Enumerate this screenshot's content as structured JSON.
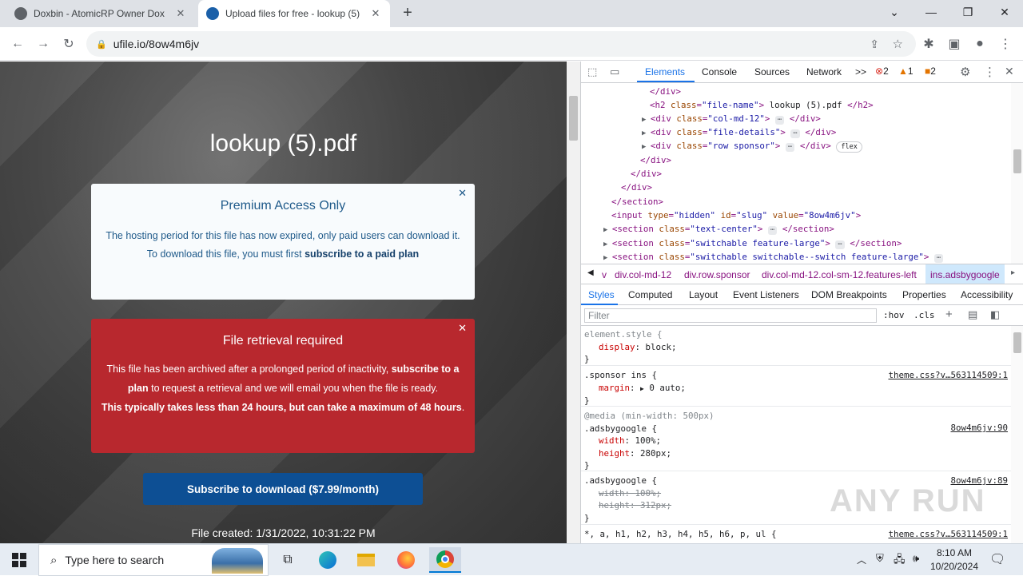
{
  "browser": {
    "tabs": [
      {
        "title": "Doxbin - AtomicRP Owner Dox",
        "active": false
      },
      {
        "title": "Upload files for free - lookup (5)",
        "active": true
      }
    ],
    "url": "ufile.io/8ow4m6jv",
    "new_tab_label": "+"
  },
  "page": {
    "file_name": "lookup (5).pdf",
    "premium": {
      "title": "Premium Access Only",
      "line1": "The hosting period for this file has now expired, only paid users can download it.",
      "line2_prefix": "To download this file, you must first ",
      "line2_link": "subscribe to a paid plan"
    },
    "retrieval": {
      "title": "File retrieval required",
      "text_prefix": "This file has been archived after a prolonged period of inactivity, ",
      "text_link": "subscribe to a plan",
      "text_suffix": " to request a retrieval and we will email you when the file is ready.",
      "bold_line": "This typically takes less than 24 hours, but can take a maximum of 48 hours",
      "bold_suffix": "."
    },
    "subscribe_button": "Subscribe to download ($7.99/month)",
    "file_created": "File created: 1/31/2022, 10:31:22 PM"
  },
  "devtools": {
    "tabs": [
      "Elements",
      "Console",
      "Sources",
      "Network"
    ],
    "more": ">>",
    "errors": "2",
    "warnings": "1",
    "issues": "2",
    "dom": {
      "l1": "</div>",
      "l2_tag_open": "<h2 ",
      "l2_attr": "class",
      "l2_val": "\"file-name\"",
      "l2_text": " lookup (5).pdf ",
      "l2_close": "</h2>",
      "l3_val": "\"col-md-12\"",
      "l4_val": "\"file-details\"",
      "l5_val": "\"row sponsor\"",
      "l5_badge": "flex",
      "l6": "</div>",
      "l7": "</div>",
      "l8": "</div>",
      "l9": "</section>",
      "l10_type": "\"hidden\"",
      "l10_id": "\"slug\"",
      "l10_value": "\"8ow4m6jv\"",
      "l11_val": "\"text-center\"",
      "l12_val": "\"switchable feature-large\"",
      "l13_val": "\"switchable switchable--switch feature-large\"",
      "div_close": "</div>",
      "section_close": "</section>",
      "ellipsis": "⋯"
    },
    "breadcrumbs": [
      "v",
      "div.col-md-12",
      "div.row.sponsor",
      "div.col-md-12.col-sm-12.features-left",
      "ins.adsbygoogle"
    ],
    "panel_tabs": [
      "Styles",
      "Computed",
      "Layout",
      "Event Listeners",
      "DOM Breakpoints",
      "Properties",
      "Accessibility"
    ],
    "filter_placeholder": "Filter",
    "hov": ":hov",
    "cls": ".cls",
    "styles": {
      "r1_sel": "element.style {",
      "r1_p": "display",
      "r1_v": "block;",
      "r2_sel": ".sponsor ins {",
      "r2_src": "theme.css?v…563114509:1",
      "r2_p": "margin",
      "r2_v": "0 auto;",
      "r3_media": "@media (min-width: 500px)",
      "r3_sel": ".adsbygoogle {",
      "r3_src": "8ow4m6jv:90",
      "r3_p1": "width",
      "r3_v1": "100%;",
      "r3_p2": "height",
      "r3_v2": "280px;",
      "r4_sel": ".adsbygoogle {",
      "r4_src": "8ow4m6jv:89",
      "r4_p1": "width",
      "r4_v1": "100%;",
      "r4_p2": "height",
      "r4_v2": "312px;",
      "r5_sel": "*, a, h1, h2, h3, h4, h5, h6, p, ul {",
      "r5_src": "theme.css?v…563114509:1",
      "close": "}"
    },
    "watermark": "ANY RUN"
  },
  "taskbar": {
    "search_placeholder": "Type here to search",
    "time": "8:10 AM",
    "date": "10/20/2024"
  },
  "colors": {
    "alert_red": "#b8282e",
    "button_blue": "#0d4f94",
    "devtools_accent": "#1a73e8"
  }
}
